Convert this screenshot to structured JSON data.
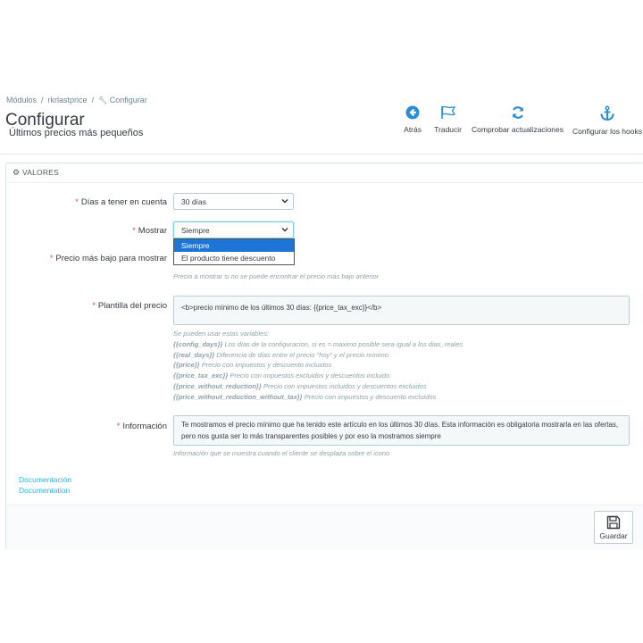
{
  "breadcrumb": [
    "Módulos",
    "rkrlastprice",
    "Configurar"
  ],
  "header": {
    "title": "Configurar",
    "subtitle": "Últimos precios más pequeños"
  },
  "toolbar": {
    "back": "Atrás",
    "translate": "Traducir",
    "check_updates": "Comprobar actualizaciones",
    "configure_hooks": "Configurar los hooks"
  },
  "panel": {
    "heading": "VALORES"
  },
  "form": {
    "days": {
      "label": "Días a tener en cuenta",
      "value": "30 días"
    },
    "show": {
      "label": "Mostrar",
      "value": "Siempre",
      "options": [
        "Siempre",
        "El producto tiene descuento"
      ]
    },
    "lowest_price": {
      "label": "Precio más bajo para mostrar",
      "help": "Precio a mostrar si no se puede encontrar el precio más bajo anterior"
    },
    "template": {
      "label": "Plantilla del precio",
      "value": "<b>precio mínimo de los últimos 30 días: {{price_tax_exc}}</b>",
      "help_intro": "Se pueden usar estas variables:",
      "variables": [
        {
          "name": "{{config_days}}",
          "desc": "Los días de la configuracion, si es = maximo posible sera igual a los dias_reales"
        },
        {
          "name": "{{real_days}}",
          "desc": "Diferencia de días entre el precio \"hoy\" y el precio mínimo"
        },
        {
          "name": "{{price}}",
          "desc": "Precio con impuestos y descuento incluidos"
        },
        {
          "name": "{{price_tax_exc}}",
          "desc": "Precio con impuestos excluidos y descuentos incluido"
        },
        {
          "name": "{{price_without_reduction}}",
          "desc": "Precio con impuestos incluidos y descuentos excluidos"
        },
        {
          "name": "{{price_without_reduction_without_tax}}",
          "desc": "Precio con impuestos y descuento excluidos"
        }
      ]
    },
    "info": {
      "label": "Información",
      "value": "Te mostramos el precio mínimo que ha tenido este artículo en los últimos 30 días. Esta información es obligatoria mostrarla en las ofertas, pero nos gusta ser lo más transparentes posibles y por eso la mostramos siempre",
      "help": "Información que se muestra cuando el cliente se desplaza sobre el icono"
    }
  },
  "links": {
    "doc_es": "Documentación",
    "doc_en": "Documentation"
  },
  "footer": {
    "save": "Guardar"
  },
  "icons": {
    "back": "arrow-circle-left-icon",
    "translate": "flag-icon",
    "check_updates": "refresh-icon",
    "configure_hooks": "anchor-icon",
    "save": "floppy-disk-icon",
    "heading": "cogs-icon",
    "breadcrumb_configure": "wrench-icon"
  },
  "colors": {
    "accent": "#25b9d7",
    "required": "#e3504f",
    "selected_option": "#1f75d6",
    "icon_blue": "#2a8dd4"
  }
}
